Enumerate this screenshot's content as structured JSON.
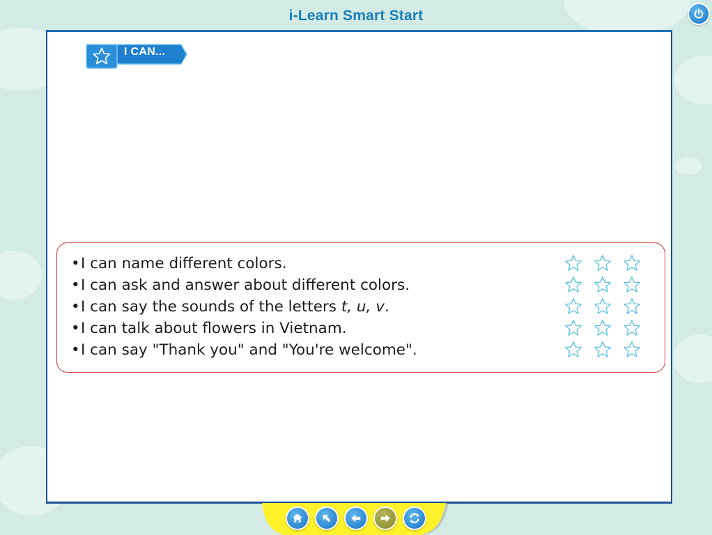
{
  "app": {
    "title": "i-Learn Smart Start"
  },
  "header": {
    "power_icon": "power-icon"
  },
  "section": {
    "badge_label": "I CAN...",
    "badge_icon": "star-outline-icon"
  },
  "can_do": {
    "bullet": "•",
    "items": [
      {
        "id": "colors-name",
        "segments": [
          {
            "text": "I can name different colors.",
            "style": "normal"
          }
        ]
      },
      {
        "id": "colors-ask",
        "segments": [
          {
            "text": "I can ask and answer about different colors.",
            "style": "normal"
          }
        ]
      },
      {
        "id": "letter-sounds",
        "segments": [
          {
            "text": "I can say the sounds of the letters ",
            "style": "normal"
          },
          {
            "text": "t, u, v",
            "style": "italic"
          },
          {
            "text": ".",
            "style": "normal"
          }
        ]
      },
      {
        "id": "flowers",
        "segments": [
          {
            "text": "I can talk about flowers in Vietnam.",
            "style": "normal"
          }
        ]
      },
      {
        "id": "thanks",
        "segments": [
          {
            "text": "I can say \"Thank you\" and \"You're welcome\".",
            "style": "normal"
          }
        ]
      }
    ],
    "stars_per_row": 3,
    "rating": [
      0,
      0,
      0,
      0,
      0
    ],
    "max_rating": 3
  },
  "nav": {
    "buttons": [
      {
        "name": "home-button",
        "icon": "home-icon",
        "state": "active"
      },
      {
        "name": "back-to-menu-button",
        "icon": "arrow-up-left-icon",
        "state": "active"
      },
      {
        "name": "previous-page-button",
        "icon": "arrow-left-icon",
        "state": "active"
      },
      {
        "name": "next-page-button",
        "icon": "arrow-right-icon",
        "state": "disabled"
      },
      {
        "name": "replay-button",
        "icon": "refresh-icon",
        "state": "active"
      }
    ]
  },
  "colors": {
    "title": "#1a7fb8",
    "frame": "#1b4f96",
    "box_border": "#cf3a40",
    "star_outline": "#5fc3e0",
    "badge": "#2a8fd8",
    "nav_active": "#1f7fd0",
    "nav_disabled": "#9a9b3e",
    "tray": "#fff22a",
    "background": "#d2ebe5"
  }
}
